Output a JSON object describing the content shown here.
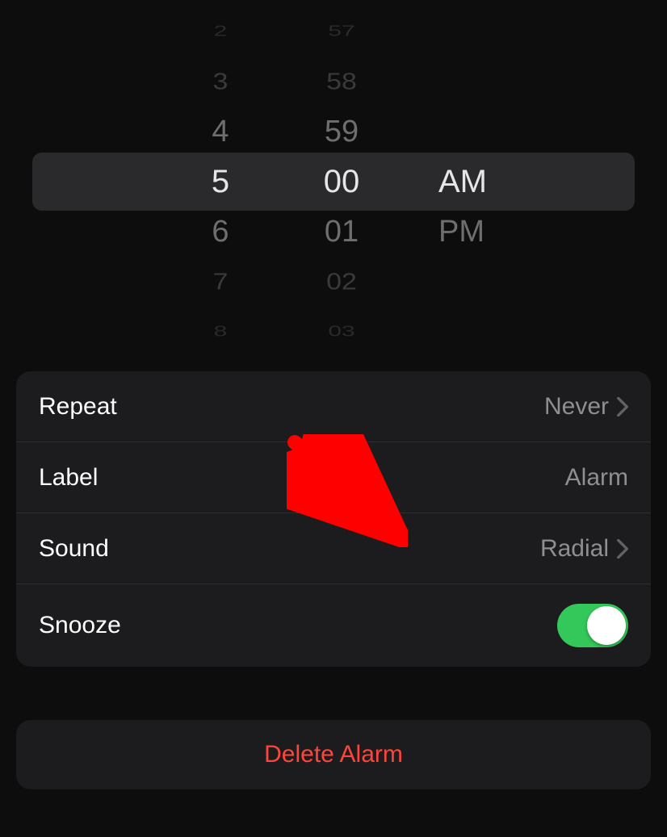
{
  "time_picker": {
    "hours_visible": [
      "2",
      "3",
      "4",
      "5",
      "6",
      "7",
      "8"
    ],
    "minutes_visible": [
      "57",
      "58",
      "59",
      "00",
      "01",
      "02",
      "03"
    ],
    "ampm_visible": [
      "AM",
      "PM"
    ],
    "selected_hour": "5",
    "selected_minute": "00",
    "selected_ampm": "AM"
  },
  "settings": {
    "repeat": {
      "label": "Repeat",
      "value": "Never"
    },
    "label": {
      "label": "Label",
      "value": "Alarm"
    },
    "sound": {
      "label": "Sound",
      "value": "Radial"
    },
    "snooze": {
      "label": "Snooze",
      "enabled": true
    }
  },
  "delete_label": "Delete Alarm",
  "colors": {
    "toggle_on": "#34c759",
    "delete_text": "#ff453a"
  }
}
